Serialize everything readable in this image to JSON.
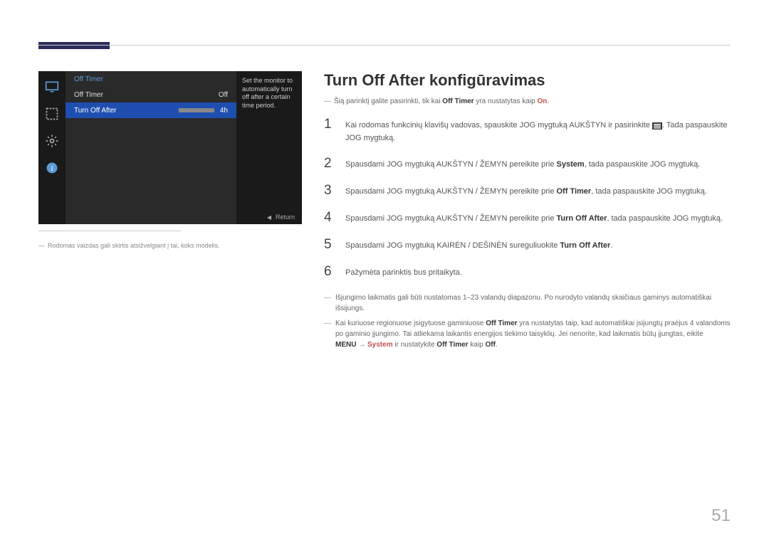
{
  "page_number": "51",
  "osd": {
    "menu_title": "Off Timer",
    "row1_label": "Off Timer",
    "row1_value": "Off",
    "row2_label": "Turn Off After",
    "row2_value": "4h",
    "description": "Set the monitor to automatically turn off after a certain time period.",
    "footer_return": "Return"
  },
  "disclaimer": "Rodomas vaizdas gali skirtis atsižvelgiant į tai, koks modelis.",
  "content": {
    "title": "Turn Off After konfigūravimas",
    "intro_prefix": "Šią parinktį galite pasirinkti, tik kai ",
    "intro_bold": "Off Timer",
    "intro_mid": " yra nustatytas kaip ",
    "intro_accent": "On",
    "intro_suffix": ".",
    "steps": {
      "1": {
        "pre": "Kai rodomas funkcinių klavišų vadovas, spauskite JOG mygtuką AUKŠTYN ir pasirinkite ",
        "post": ". Tada paspauskite JOG mygtuką."
      },
      "2": {
        "pre": "Spausdami JOG mygtuką AUKŠTYN / ŽEMYN pereikite prie ",
        "bold": "System",
        "post": ", tada paspauskite JOG mygtuką."
      },
      "3": {
        "pre": "Spausdami JOG mygtuką AUKŠTYN / ŽEMYN pereikite prie ",
        "bold": "Off Timer",
        "post": ", tada paspauskite JOG mygtuką."
      },
      "4": {
        "pre": "Spausdami JOG mygtuką AUKŠTYN / ŽEMYN pereikite prie ",
        "bold": "Turn Off After",
        "post": ", tada paspauskite JOG mygtuką."
      },
      "5": {
        "pre": "Spausdami JOG mygtuką KAIRĖN / DEŠINĖN sureguliuokite ",
        "bold": "Turn Off After",
        "post": "."
      },
      "6": "Pažymėta parinktis bus pritaikyta."
    },
    "notes": {
      "n1": "Išjungimo laikmatis gali būti nustatomas 1–23 valandų diapazonu. Po nurodyto valandų skaičiaus gaminys automatiškai išsijungs.",
      "n2_pre": "Kai kuriuose regionuose įsigytuose gaminiuose ",
      "n2_bold1": "Off Timer",
      "n2_mid": " yra nustatytas taip, kad automatiškai įsijungtų praėjus 4 valandoms po gaminio įjungimo. Tai atliekama laikantis energijos tiekimo taisyklių. Jei nenorite, kad laikmatis būtų įjungtas, eikite ",
      "n2_bold2": "MENU",
      "n2_arrow": " → ",
      "n2_accent1": "System",
      "n2_mid2": " ir nustatykite ",
      "n2_bold3": "Off Timer",
      "n2_mid3": " kaip ",
      "n2_bold4": "Off",
      "n2_suffix": "."
    }
  }
}
